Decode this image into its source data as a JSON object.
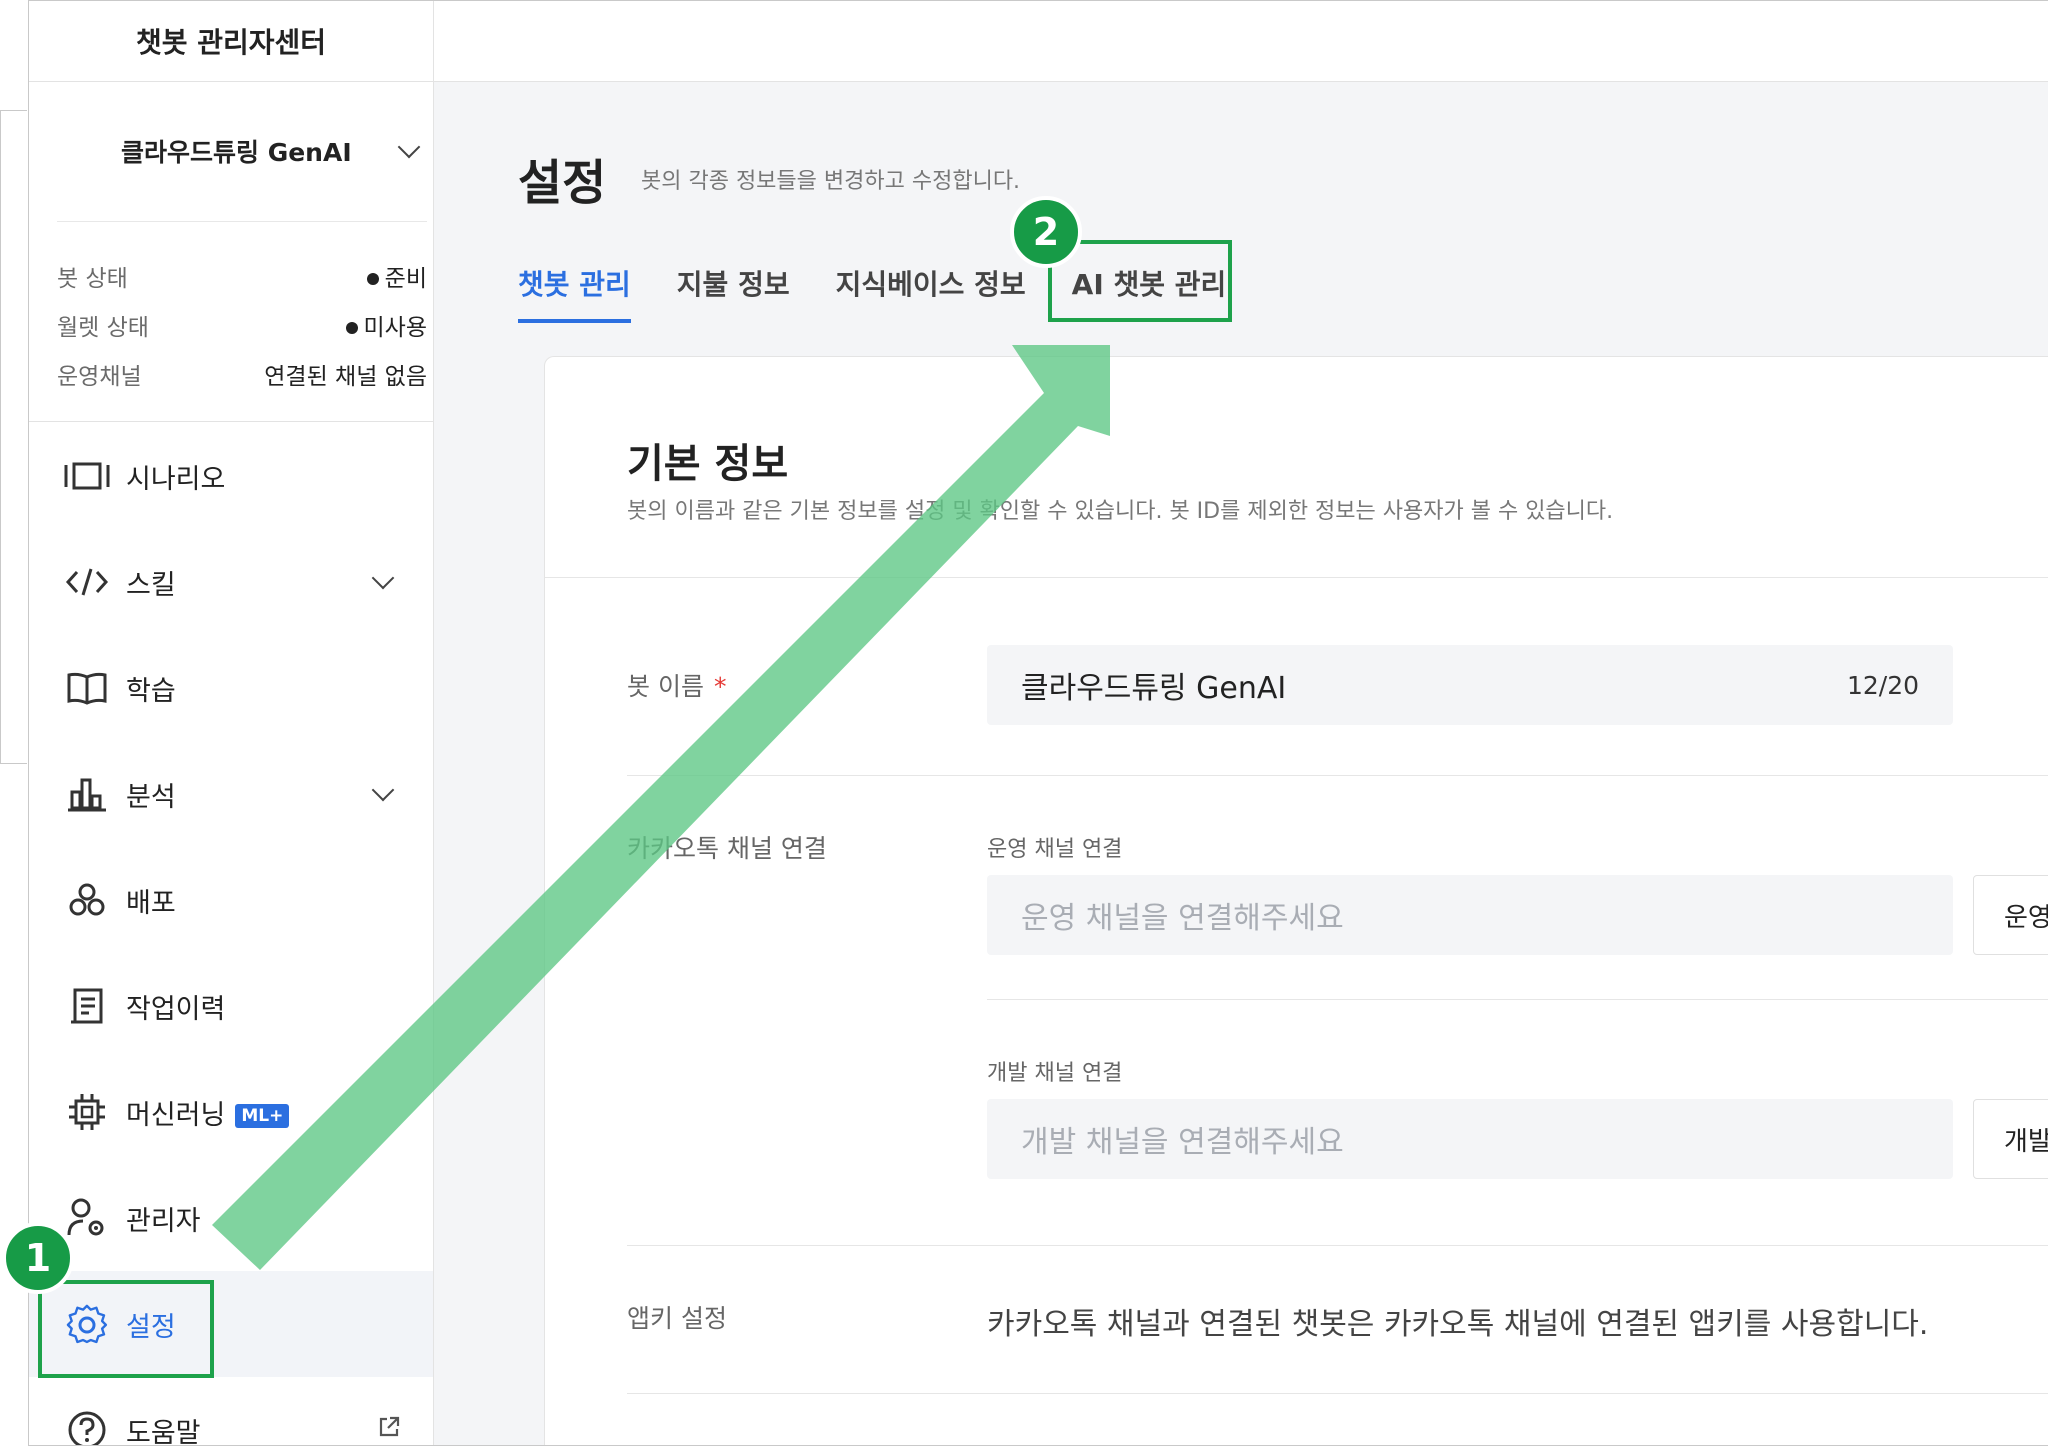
{
  "app_title": "챗봇 관리자센터",
  "bot_selector": {
    "name": "클라우드튜링 GenAI"
  },
  "status": [
    {
      "label": "봇 상태",
      "value": "준비",
      "dot": true
    },
    {
      "label": "월렛 상태",
      "value": "미사용",
      "dot": true
    },
    {
      "label": "운영채널",
      "value": "연결된 채널 없음",
      "dot": false
    }
  ],
  "nav": [
    {
      "label": "시나리오",
      "icon": "scenario-icon",
      "has_chevron": false
    },
    {
      "label": "스킬",
      "icon": "code-icon",
      "has_chevron": true
    },
    {
      "label": "학습",
      "icon": "book-icon",
      "has_chevron": false
    },
    {
      "label": "분석",
      "icon": "chart-icon",
      "has_chevron": true
    },
    {
      "label": "배포",
      "icon": "deploy-icon",
      "has_chevron": false
    },
    {
      "label": "작업이력",
      "icon": "history-icon",
      "has_chevron": false
    },
    {
      "label": "머신러닝",
      "icon": "chip-icon",
      "badge": "ML+",
      "has_chevron": false
    },
    {
      "label": "관리자",
      "icon": "admin-icon",
      "has_chevron": false
    },
    {
      "label": "설정",
      "icon": "gear-icon",
      "active": true,
      "has_chevron": false
    },
    {
      "label": "도움말",
      "icon": "help-icon",
      "external": true,
      "has_chevron": false
    }
  ],
  "page": {
    "title": "설정",
    "subtitle": "봇의 각종 정보들을 변경하고 수정합니다.",
    "tabs": [
      {
        "label": "챗봇 관리",
        "active": true
      },
      {
        "label": "지불 정보",
        "active": false
      },
      {
        "label": "지식베이스 정보",
        "active": false
      },
      {
        "label": "AI 챗봇 관리",
        "active": false
      }
    ]
  },
  "basic_info": {
    "title": "기본 정보",
    "subtitle": "봇의 이름과 같은 기본 정보를 설정 및 확인할 수 있습니다. 봇 ID를 제외한 정보는 사용자가 볼 수 있습니다.",
    "bot_name_label": "봇 이름",
    "required_mark": "*",
    "bot_name_value": "클라우드튜링 GenAI",
    "bot_name_counter": "12/20",
    "kakao_label": "카카오톡 채널 연결",
    "ops_channel_label": "운영 채널 연결",
    "ops_channel_placeholder": "운영 채널을 연결해주세요",
    "ops_channel_button": "운영 채널 연결",
    "dev_channel_label": "개발 채널 연결",
    "dev_channel_placeholder": "개발 채널을 연결해주세요",
    "dev_channel_button": "개발 채널 연결",
    "appkey_label": "앱키 설정",
    "appkey_text": "카카오톡 채널과 연결된 챗봇은 카카오톡 채널에 연결된 앱키를 사용합니다."
  },
  "annotations": {
    "step1": "1",
    "step2": "2",
    "color": "#1ea24b"
  }
}
